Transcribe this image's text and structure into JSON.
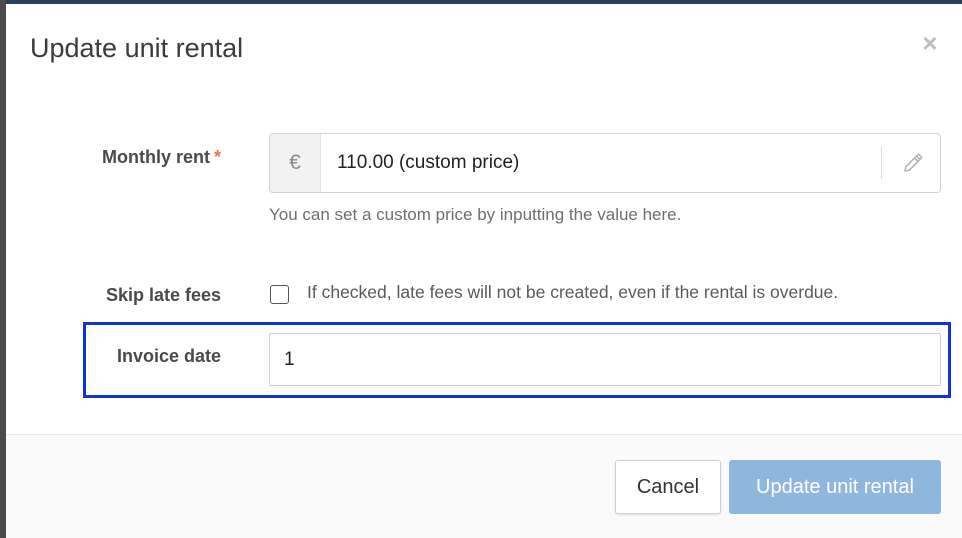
{
  "modal": {
    "title": "Update unit rental",
    "close_symbol": "×"
  },
  "form": {
    "monthly_rent": {
      "label": "Monthly rent",
      "required_mark": "*",
      "currency_symbol": "€",
      "value": "110.00 (custom price)",
      "help": "You can set a custom price by inputting the value here.",
      "edit_icon": "pencil-icon"
    },
    "skip_late_fees": {
      "label": "Skip late fees",
      "checked": false,
      "description": "If checked, late fees will not be created, even if the rental is overdue."
    },
    "invoice_date": {
      "label": "Invoice date",
      "value": "1",
      "highlight_color": "#1433d6"
    }
  },
  "footer": {
    "cancel_label": "Cancel",
    "submit_label": "Update unit rental"
  },
  "colors": {
    "primary_button": "#8fb7de",
    "required": "#e8704f"
  }
}
